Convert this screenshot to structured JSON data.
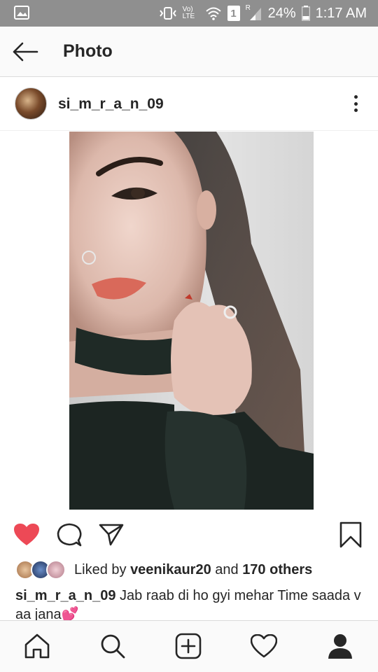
{
  "status_bar": {
    "network_label": "Vo) LTE",
    "sim_label": "1",
    "roaming_label": "R",
    "battery_percent": "24%",
    "time": "1:17 AM",
    "icons": [
      "image-notification-icon",
      "vibrate-icon",
      "wifi-icon",
      "signal-icon",
      "battery-icon"
    ]
  },
  "header": {
    "title": "Photo",
    "back_icon": "arrow-left-icon"
  },
  "post": {
    "username": "si_m_r_a_n_09",
    "more_icon": "vertical-ellipsis-icon",
    "photo_description_icon": "photo"
  },
  "actions": {
    "like_icon": "heart-filled-icon",
    "comment_icon": "comment-icon",
    "share_icon": "paper-plane-icon",
    "save_icon": "bookmark-icon",
    "liked_color": "#ed4956"
  },
  "likes": {
    "prefix": "Liked by ",
    "user": "veenikaur20",
    "middle": " and ",
    "others": "170 others"
  },
  "caption": {
    "username": "si_m_r_a_n_09",
    "text": " Jab raab di ho gyi mehar Time saada v aa jana",
    "emoji": "💕"
  },
  "bottom_nav": {
    "items": [
      "home-icon",
      "search-icon",
      "add-post-icon",
      "activity-heart-icon",
      "profile-icon"
    ]
  }
}
